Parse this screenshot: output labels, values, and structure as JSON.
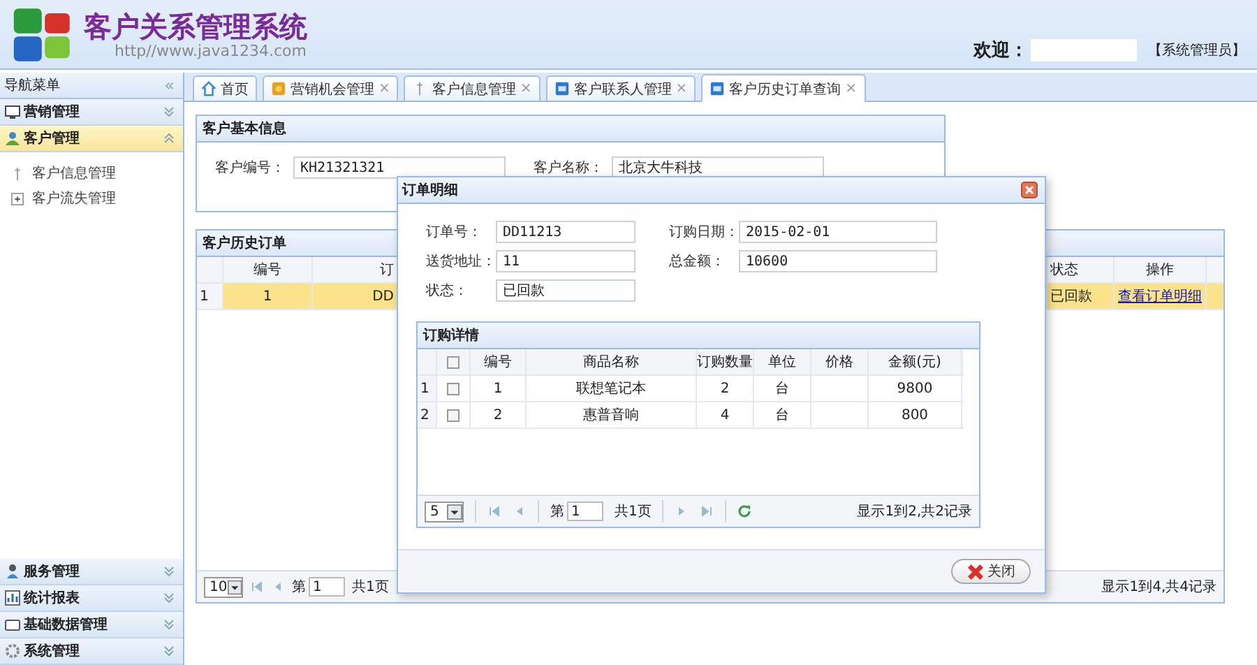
{
  "header": {
    "title": "客户关系管理系统",
    "url": "http//www.java1234.com",
    "welcome_label": "欢迎：",
    "role": "【系统管理员】"
  },
  "sidebar": {
    "title": "导航菜单",
    "collapse": "«",
    "sections": [
      {
        "label": "营销管理",
        "expanded": false
      },
      {
        "label": "客户管理",
        "expanded": true,
        "items": [
          {
            "label": "客户信息管理"
          },
          {
            "label": "客户流失管理"
          }
        ]
      },
      {
        "label": "服务管理",
        "expanded": false
      },
      {
        "label": "统计报表",
        "expanded": false
      },
      {
        "label": "基础数据管理",
        "expanded": false
      },
      {
        "label": "系统管理",
        "expanded": false
      }
    ]
  },
  "tabs": [
    {
      "label": "首页",
      "selected": false
    },
    {
      "label": "营销机会管理",
      "close": "×",
      "selected": false
    },
    {
      "label": "客户信息管理",
      "close": "×",
      "selected": false
    },
    {
      "label": "客户联系人管理",
      "close": "×",
      "selected": false
    },
    {
      "label": "客户历史订单查询",
      "close": "×",
      "selected": true
    }
  ],
  "basic_info": {
    "title": "客户基本信息",
    "fields": [
      {
        "label": "客户编号：",
        "value": "KH21321321"
      },
      {
        "label": "客户名称：",
        "value": "北京大牛科技"
      }
    ]
  },
  "history": {
    "title": "客户历史订单",
    "columns": [
      "编号",
      "订",
      "状态",
      "操作"
    ],
    "rows": [
      {
        "row_number": "1",
        "number": "1",
        "column_2": "DD",
        "status": "已回款",
        "action": "查看订单明细",
        "selected": true
      }
    ],
    "pager": {
      "page_size": "10",
      "page_label": "第",
      "page": "1",
      "total_pages": "共1页",
      "summary": "显示1到4,共4记录"
    }
  },
  "dialog": {
    "title": "订单明细",
    "fields": [
      {
        "label": "订单号：",
        "value": "DD11213"
      },
      {
        "label": "订购日期：",
        "value": "2015-02-01"
      },
      {
        "label": "送货地址：",
        "value": "11"
      },
      {
        "label": "总金额：",
        "value": "10600"
      },
      {
        "label": "状态：",
        "value": "已回款"
      }
    ],
    "details": {
      "title": "订购详情",
      "header_checked": false,
      "columns": [
        "编号",
        "商品名称",
        "订购数量",
        "单位",
        "价格",
        "金额(元)"
      ],
      "rows": [
        {
          "row_number": "1",
          "checked": false,
          "number": "1",
          "name": "联想笔记本",
          "quantity": "2",
          "unit": "台",
          "amount": "9800"
        },
        {
          "row_number": "2",
          "checked": false,
          "number": "2",
          "name": "惠普音响",
          "quantity": "4",
          "unit": "台",
          "amount": "800"
        }
      ],
      "pager": {
        "page_size": "5",
        "page_label": "第",
        "page": "1",
        "total_pages": "共1页",
        "summary": "显示1到2,共2记录"
      }
    },
    "close_button": "关闭"
  }
}
